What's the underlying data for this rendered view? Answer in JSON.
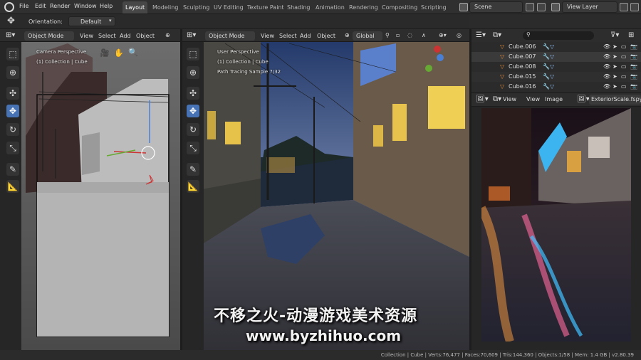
{
  "topbar": {
    "menus": [
      "File",
      "Edit",
      "Render",
      "Window",
      "Help"
    ],
    "tabs": [
      "Layout",
      "Modeling",
      "Sculpting",
      "UV Editing",
      "Texture Paint",
      "Shading",
      "Animation",
      "Rendering",
      "Compositing",
      "Scripting"
    ],
    "active_tab": "Layout",
    "scene": "Scene",
    "view_layer": "View Layer"
  },
  "toolheader": {
    "orientation_label": "Orientation:",
    "orientation_value": "Default"
  },
  "left_viewport": {
    "mode": "Object Mode",
    "menus": [
      "View",
      "Select",
      "Add",
      "Object"
    ],
    "perspective": "Camera Perspective",
    "collection": "(1) Collection | Cube"
  },
  "mid_viewport": {
    "mode": "Object Mode",
    "menus": [
      "View",
      "Select",
      "Add",
      "Object"
    ],
    "transform": "Global",
    "perspective": "User Perspective",
    "collection": "(1) Collection | Cube",
    "sample": "Path Tracing Sample 7/32"
  },
  "outliner": {
    "items": [
      "Cube.006",
      "Cube.007",
      "Cube.008",
      "Cube.015",
      "Cube.016"
    ]
  },
  "image_editor": {
    "menus": [
      "View",
      "View",
      "Image"
    ],
    "filename": "ExteriorScale.fspy"
  },
  "statusbar": "Collection | Cube | Verts:76,477 | Faces:70,609 | Tris:144,360 | Objects:1/58 | Mem: 1.4 GB | v2.80.39",
  "watermark": {
    "line1": "不移之火-动漫游戏美术资源",
    "line2": "www.byzhihuo.com"
  },
  "colors": {
    "accent": "#4772b3",
    "header": "#303030",
    "panel": "#2d2d2d"
  }
}
